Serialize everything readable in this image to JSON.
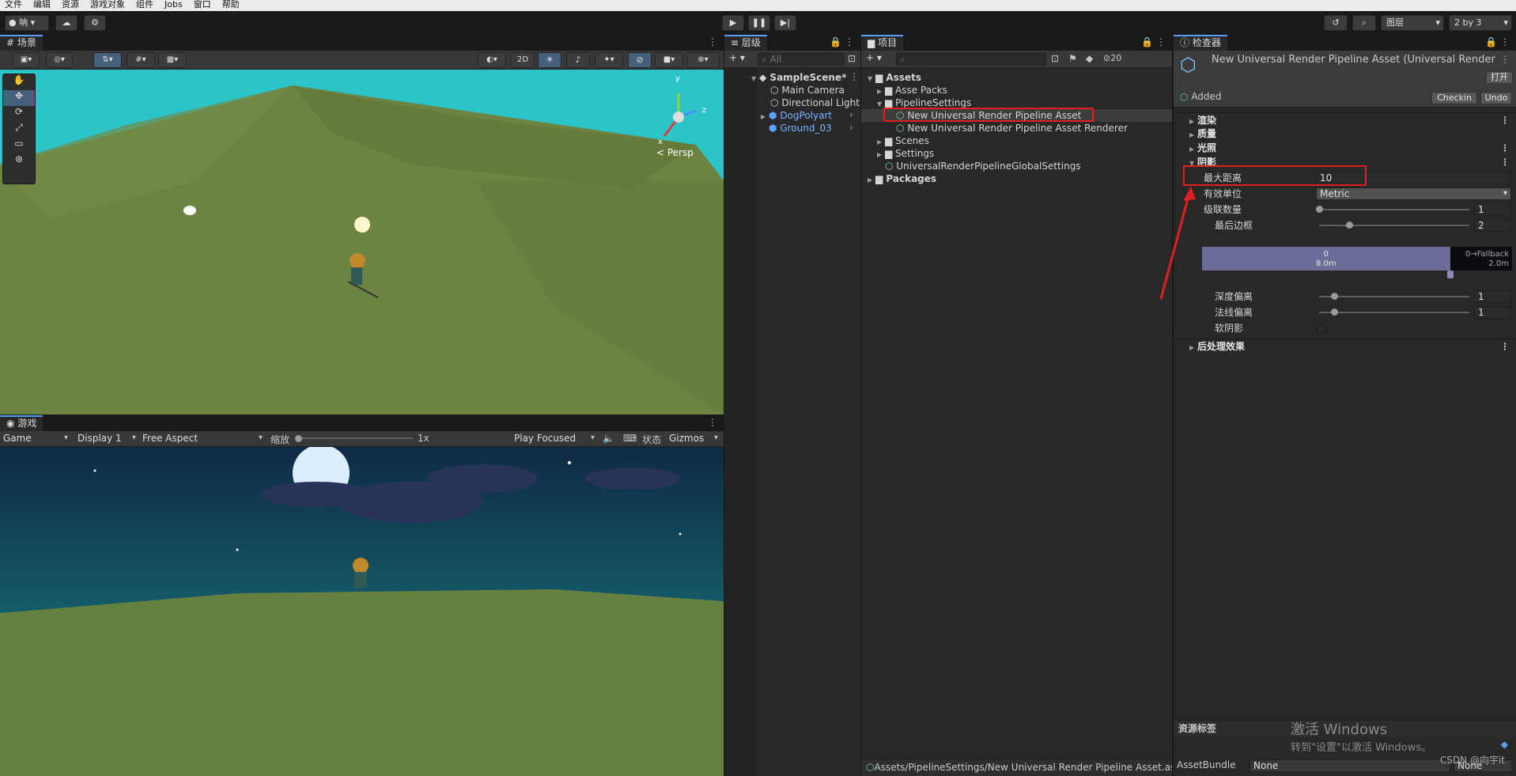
{
  "menu": [
    "文件",
    "编辑",
    "资源",
    "游戏对象",
    "组件",
    "Jobs",
    "窗口",
    "帮助"
  ],
  "toolbar": {
    "account": "呐",
    "layers": "图层",
    "layout": "2 by 3"
  },
  "scene": {
    "tab": "场景",
    "mode_2d": "2D",
    "persp": "< Persp",
    "axis_y": "y",
    "axis_z": "z",
    "axis_x": "x"
  },
  "game": {
    "tab": "游戏",
    "display_mode": "Game",
    "display": "Display 1",
    "aspect": "Free Aspect",
    "scale_label": "缩放",
    "scale_value": "1x",
    "play_mode": "Play Focused",
    "stats": "状态",
    "gizmos": "Gizmos"
  },
  "hierarchy": {
    "tab": "层级",
    "search_placeholder": "All",
    "scene_name": "SampleScene*",
    "items": [
      "Main Camera",
      "Directional Light",
      "DogPolyart",
      "Ground_03"
    ]
  },
  "project": {
    "tab": "项目",
    "hidden_count": "20",
    "root": "Assets",
    "items": [
      "Asse Packs",
      "PipelineSettings",
      "New Universal Render Pipeline Asset",
      "New Universal Render Pipeline Asset Renderer",
      "Scenes",
      "Settings",
      "UniversalRenderPipelineGlobalSettings"
    ],
    "packages": "Packages",
    "status_path": "Assets/PipelineSettings/New Universal Render Pipeline Asset.as"
  },
  "inspector": {
    "tab": "检查器",
    "title": "New Universal Render Pipeline Asset (Universal Render Pi",
    "open_button": "打开",
    "added": "Added",
    "checkin": "Checkin",
    "undo": "Undo",
    "sections": [
      "渲染",
      "质量",
      "光照",
      "阴影",
      "后处理效果"
    ],
    "max_distance_label": "最大距离",
    "max_distance_value": "10",
    "working_unit_label": "有效单位",
    "working_unit_value": "Metric",
    "cascade_count_label": "级联数量",
    "cascade_count_value": "1",
    "cascade_count_fraction": 0.0,
    "last_border_label": "最后边框",
    "last_border_value": "2",
    "last_border_fraction": 0.2,
    "cascade_bar": {
      "c0_label": "0",
      "c0_value": "8.0m",
      "fallback_label": "0→Fallback",
      "fallback_value": "2.0m",
      "split_fraction": 0.8
    },
    "depth_bias_label": "深度偏离",
    "depth_bias_value": "1",
    "depth_bias_fraction": 0.1,
    "normal_bias_label": "法线偏离",
    "normal_bias_value": "1",
    "normal_bias_fraction": 0.1,
    "soft_shadows_label": "软阴影",
    "asset_labels": "资源标签",
    "asset_bundle_label": "AssetBundle",
    "asset_bundle_value": "None",
    "asset_bundle_variant": "None",
    "watermark_title": "激活 Windows",
    "watermark_sub": "转到\"设置\"以激活 Windows。",
    "credit": "CSDN @向宇it"
  },
  "colors": {
    "accent": "#5a9cf8",
    "annotation": "#e02020",
    "sky": "#2bc4c8",
    "ground": "#66803f"
  }
}
